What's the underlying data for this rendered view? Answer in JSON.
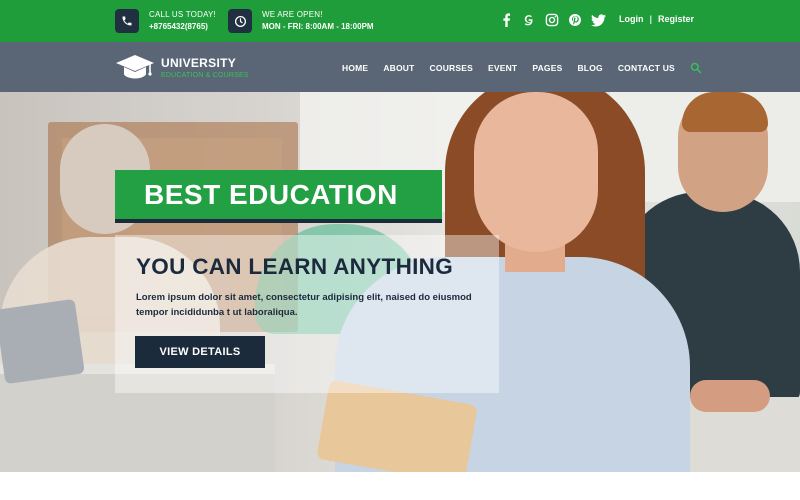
{
  "topbar": {
    "contacts": [
      {
        "icon": "phone-icon",
        "label": "CALL US TODAY!",
        "value": "+8765432(8765)"
      },
      {
        "icon": "clock-icon",
        "label": "WE ARE OPEN!",
        "value": "MON - FRI: 8:00AM - 18:00PM"
      }
    ],
    "socials": [
      "facebook-icon",
      "google-plus-icon",
      "instagram-icon",
      "pinterest-icon",
      "twitter-icon"
    ],
    "login": "Login",
    "register": "Register",
    "separator": "|"
  },
  "nav": {
    "logo_title": "UNIVERSITY",
    "logo_subtitle": "EDUCATION & COURSES",
    "items": [
      "HOME",
      "ABOUT",
      "COURSES",
      "EVENT",
      "PAGES",
      "BLOG",
      "CONTACT US"
    ]
  },
  "hero": {
    "badge": "BEST EDUCATION",
    "title": "YOU CAN LEARN ANYTHING",
    "text": "Lorem ipsum dolor sit amet, consectetur adipising elit, naised do eiusmod tempor incididunba t ut laboraliqua.",
    "button": "VIEW DETAILS"
  },
  "colors": {
    "green": "#1f9d3a",
    "navy": "#1c2b3b",
    "nav_gray": "#5a6675",
    "accent_green": "#35c35a"
  }
}
